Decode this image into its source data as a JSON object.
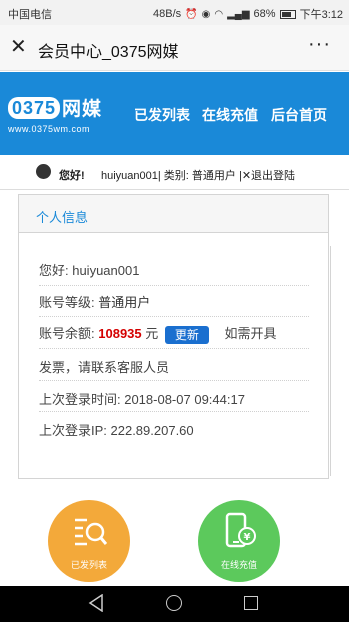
{
  "statusbar": {
    "carrier": "中国电信",
    "speed": "48B/s",
    "battery": "68%",
    "time": "下午3:12"
  },
  "titlebar": {
    "title": "会员中心_0375网媒",
    "more": "···",
    "close": "✕"
  },
  "header": {
    "logo_digits": "0375",
    "logo_cn": "网媒",
    "logo_url": "www.0375wm.com",
    "nav": [
      "已发列表",
      "在线充值",
      "后台首页"
    ],
    "bg_color": "#1a89d8"
  },
  "userbar": {
    "hello": "您好!",
    "info": "huiyuan001|  类别:  普通用户   |✕退出登陆"
  },
  "card": {
    "title": "个人信息",
    "greeting": "您好:  huiyuan001",
    "level_label": "账号等级:",
    "level_value": "普通用户",
    "balance_label": "账号余额:",
    "balance_value": "108935",
    "balance_unit": "元",
    "update_button": "更新",
    "invoice_note_1": "如需开具",
    "invoice_note_2": "发票，请联系客服人员",
    "last_login_time": "上次登录时间:  2018-08-07 09:44:17",
    "last_login_ip": "上次登录IP:  222.89.207.60"
  },
  "actions": {
    "list_label": "已发列表",
    "recharge_label": "在线充值",
    "list_color": "#f3a93a",
    "recharge_color": "#5cc95c"
  }
}
